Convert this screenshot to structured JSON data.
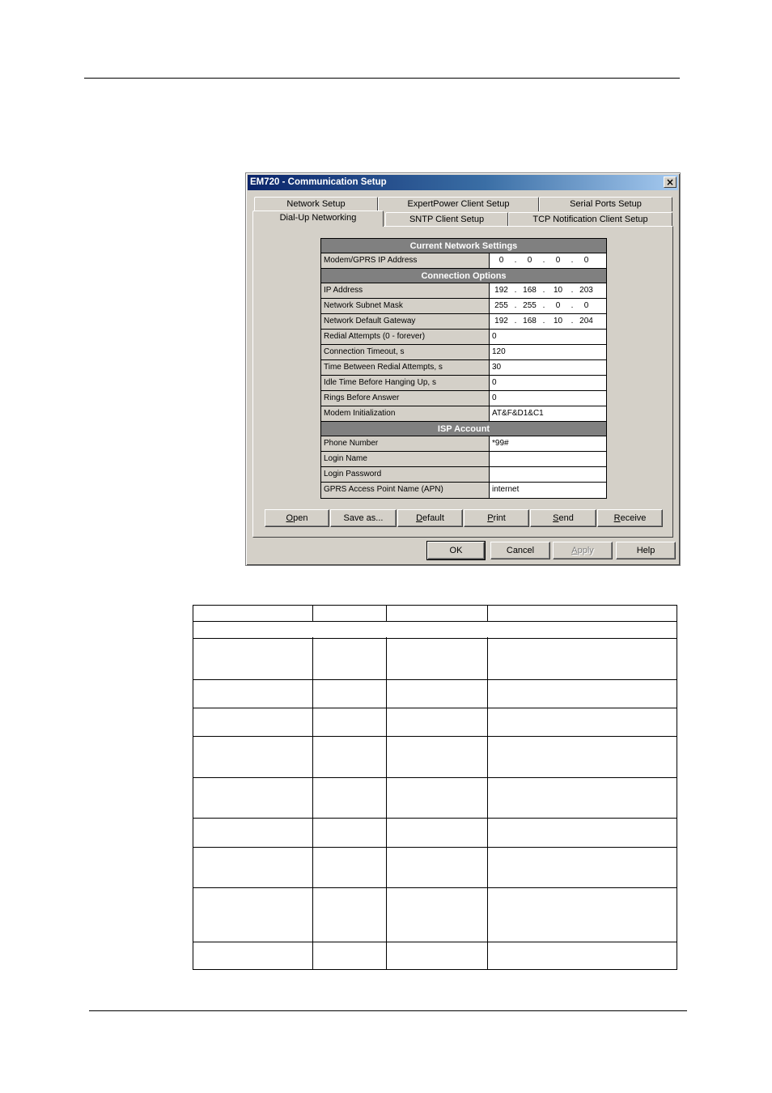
{
  "dialog": {
    "title": "EM720 - Communication Setup",
    "close_glyph": "×",
    "tabs_back": [
      "Network Setup",
      "ExpertPower Client Setup",
      "Serial Ports Setup"
    ],
    "tabs_front": [
      "Dial-Up Networking",
      "SNTP Client Setup",
      "TCP Notification Client Setup"
    ],
    "active_tab": "Dial-Up Networking",
    "sections": {
      "current": {
        "header": "Current Network Settings",
        "modem_ip_label": "Modem/GPRS IP Address",
        "modem_ip": [
          "0",
          "0",
          "0",
          "0"
        ]
      },
      "connection": {
        "header": "Connection Options",
        "ip_label": "IP Address",
        "ip": [
          "192",
          "168",
          "10",
          "203"
        ],
        "mask_label": "Network Subnet Mask",
        "mask": [
          "255",
          "255",
          "0",
          "0"
        ],
        "gateway_label": "Network Default Gateway",
        "gateway": [
          "192",
          "168",
          "10",
          "204"
        ],
        "rows": [
          {
            "label": "Redial Attempts (0 - forever)",
            "value": "0"
          },
          {
            "label": "Connection Timeout, s",
            "value": "120"
          },
          {
            "label": "Time Between Redial Attempts, s",
            "value": "30"
          },
          {
            "label": "Idle Time Before Hanging Up, s",
            "value": "0"
          },
          {
            "label": "Rings Before Answer",
            "value": "0"
          },
          {
            "label": "Modem Initialization",
            "value": "AT&F&D1&C1"
          }
        ]
      },
      "isp": {
        "header": "ISP Account",
        "rows": [
          {
            "label": "Phone Number",
            "value": "*99#"
          },
          {
            "label": "Login Name",
            "value": ""
          },
          {
            "label": "Login Password",
            "value": ""
          },
          {
            "label": "GPRS Access Point Name (APN)",
            "value": "internet"
          }
        ]
      }
    },
    "panel_buttons": {
      "open": {
        "first": "O",
        "rest": "pen"
      },
      "save_as": "Save as...",
      "default": {
        "first": "D",
        "rest": "efault"
      },
      "print": {
        "first": "P",
        "rest": "rint"
      },
      "send": {
        "first": "S",
        "rest": "end"
      },
      "receive": {
        "first": "R",
        "rest": "eceive"
      }
    },
    "dialog_buttons": {
      "ok": "OK",
      "cancel": "Cancel",
      "apply": {
        "first": "A",
        "rest": "pply"
      },
      "help": "Help"
    }
  }
}
